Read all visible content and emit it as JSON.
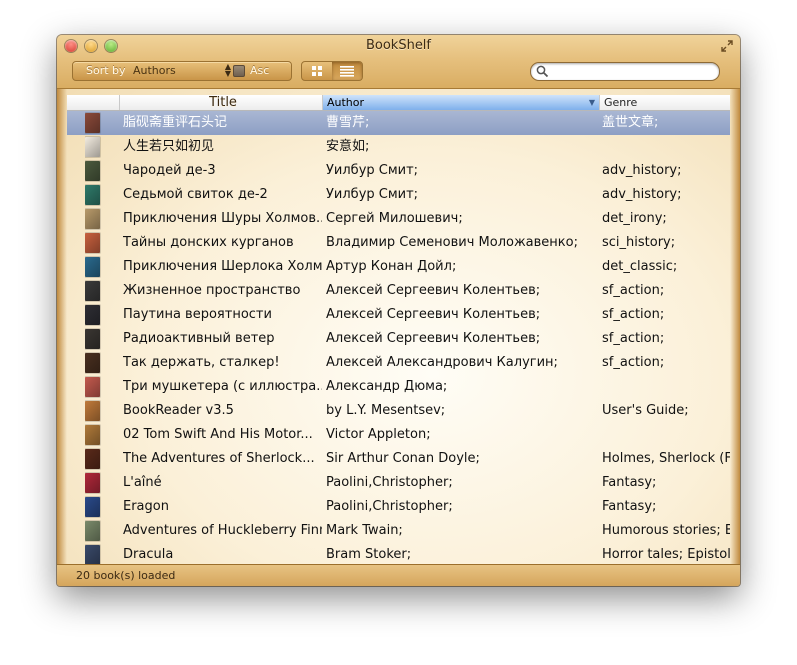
{
  "window": {
    "title": "BookShelf"
  },
  "toolbar": {
    "sort_by_label": "Sort by",
    "sort_value": "Authors",
    "asc_label": "Asc",
    "search_placeholder": ""
  },
  "table": {
    "columns": [
      {
        "label": ""
      },
      {
        "label": "Title"
      },
      {
        "label": "Author",
        "sorted": true
      },
      {
        "label": "Genre"
      }
    ],
    "rows": [
      {
        "title": "脂砚斋重评石头记",
        "author": "曹雪芹;",
        "genre": "盖世文章;",
        "thumb": "#8b4a3a",
        "selected": true
      },
      {
        "title": "人生若只如初见",
        "author": "安意如;",
        "genre": "",
        "thumb": "#f3ece0"
      },
      {
        "title": "Чародей де-3",
        "author": "Уилбур  Смит;",
        "genre": "adv_history;",
        "thumb": "#4b5a3e"
      },
      {
        "title": "Седьмой свиток де-2",
        "author": "Уилбур  Смит;",
        "genre": "adv_history;",
        "thumb": "#2f7a6a"
      },
      {
        "title": "Приключения Шуры Холмов...",
        "author": "Сергей  Милошевич;",
        "genre": "det_irony;",
        "thumb": "#b89a6a"
      },
      {
        "title": "Тайны донских курганов",
        "author": "Владимир Семенович Моложавенко;",
        "genre": "sci_history;",
        "thumb": "#c8603e"
      },
      {
        "title": "Приключения Шерлока Холмса",
        "author": "Артур Конан Дойл;",
        "genre": "det_classic;",
        "thumb": "#2a6a8e"
      },
      {
        "title": "Жизненное пространство",
        "author": "Алексей Сергеевич Колентьев;",
        "genre": "sf_action;",
        "thumb": "#3a3a3a"
      },
      {
        "title": "Паутина вероятности",
        "author": "Алексей Сергеевич Колентьев;",
        "genre": "sf_action;",
        "thumb": "#2e2e34"
      },
      {
        "title": "Радиоактивный ветер",
        "author": "Алексей Сергеевич Колентьев;",
        "genre": "sf_action;",
        "thumb": "#3a3632"
      },
      {
        "title": "Так держать, сталкер!",
        "author": "Алексей Александрович Калугин;",
        "genre": "sf_action;",
        "thumb": "#4a3020"
      },
      {
        "title": "Три мушкетера (с иллюстра...",
        "author": "Александр Дюма;",
        "genre": "",
        "thumb": "#c45a4e"
      },
      {
        "title": "BookReader v3.5",
        "author": "by L.Y. Mesentsev;",
        "genre": "User's Guide;",
        "thumb": "#c07a3a"
      },
      {
        "title": "02 Tom Swift And His Motor...",
        "author": "Victor Appleton;",
        "genre": "",
        "thumb": "#b07a3a"
      },
      {
        "title": "The Adventures of Sherlock...",
        "author": "Sir Arthur Conan Doyle;",
        "genre": "Holmes, Sherlock (Fi",
        "thumb": "#5a2a1a"
      },
      {
        "title": "L'aîné",
        "author": "Paolini,Christopher;",
        "genre": "Fantasy;",
        "thumb": "#b0283a"
      },
      {
        "title": "Eragon",
        "author": "Paolini,Christopher;",
        "genre": "Fantasy;",
        "thumb": "#2a4a8a"
      },
      {
        "title": "Adventures of Huckleberry Finn",
        "author": "Mark Twain;",
        "genre": "Humorous stories; B",
        "thumb": "#7a8a6a"
      },
      {
        "title": "Dracula",
        "author": "Bram Stoker;",
        "genre": "Horror tales; Epistol:",
        "thumb": "#3a4a6a"
      }
    ]
  },
  "status": {
    "text": "20 book(s) loaded"
  }
}
